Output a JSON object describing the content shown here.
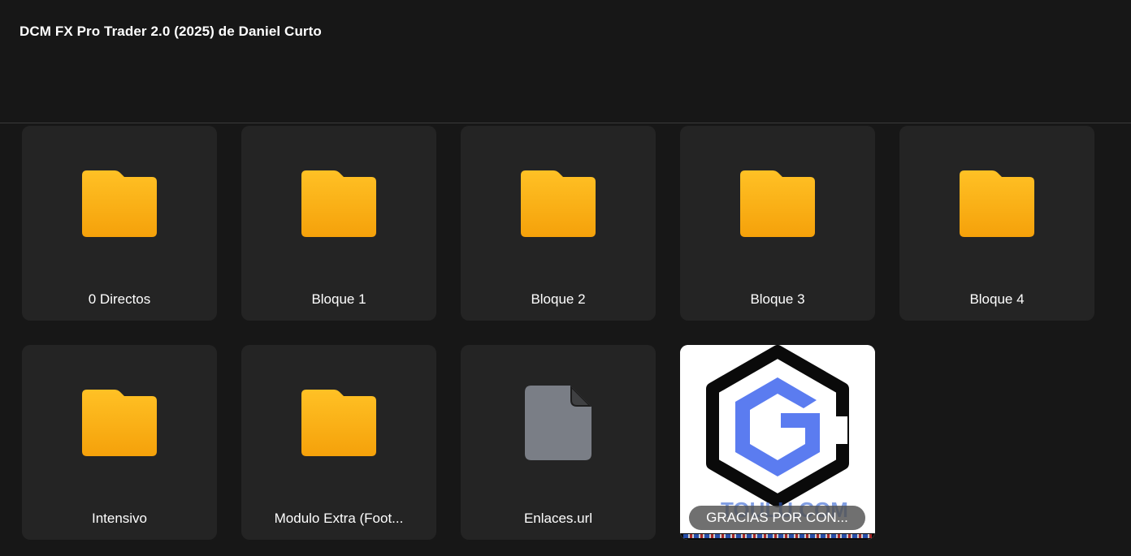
{
  "header": {
    "title": "DCM FX Pro Trader 2.0 (2025) de Daniel Curto"
  },
  "items": [
    {
      "label": "0 Directos",
      "type": "folder"
    },
    {
      "label": "Bloque 1",
      "type": "folder"
    },
    {
      "label": "Bloque 2",
      "type": "folder"
    },
    {
      "label": "Bloque 3",
      "type": "folder"
    },
    {
      "label": "Bloque 4",
      "type": "folder"
    },
    {
      "label": "Intensivo",
      "type": "folder"
    },
    {
      "label": "Modulo Extra (Foot...",
      "type": "folder"
    },
    {
      "label": "Enlaces.url",
      "type": "file"
    },
    {
      "label": "GRACIAS POR CON...",
      "type": "image"
    }
  ],
  "colors": {
    "background": "#171717",
    "tile": "#242424",
    "folder_top": "#FFC125",
    "folder_bottom": "#F5A10A",
    "file_icon": "#7A7E86",
    "logo_blue": "#5B7CF0"
  },
  "icons": {
    "folder": "folder-icon",
    "file": "file-icon"
  }
}
